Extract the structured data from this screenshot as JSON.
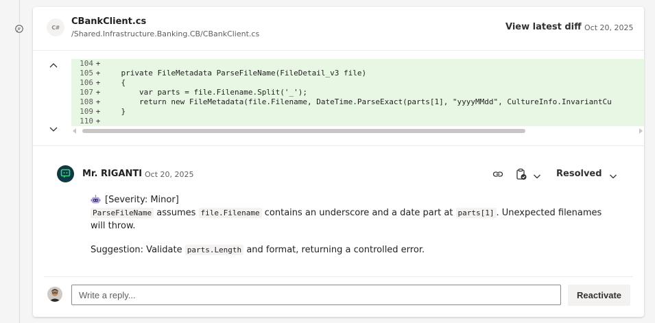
{
  "file": {
    "language_badge": "C#",
    "name": "CBankClient.cs",
    "path": "/Shared.Infrastructure.Banking.CB/CBankClient.cs",
    "view_diff_label": "View latest diff",
    "date": "Oct 20, 2025"
  },
  "diff": {
    "lines": [
      {
        "num": "104",
        "marker": "+",
        "code": ""
      },
      {
        "num": "105",
        "marker": "+",
        "code": "    private FileMetadata ParseFileName(FileDetail_v3 file)"
      },
      {
        "num": "106",
        "marker": "+",
        "code": "    {"
      },
      {
        "num": "107",
        "marker": "+",
        "code": "        var parts = file.Filename.Split('_');"
      },
      {
        "num": "108",
        "marker": "+",
        "code": "        return new FileMetadata(file.Filename, DateTime.ParseExact(parts[1], \"yyyyMMdd\", CultureInfo.InvariantCu"
      },
      {
        "num": "109",
        "marker": "+",
        "code": "    }"
      },
      {
        "num": "110",
        "marker": "+",
        "code": ""
      }
    ],
    "added_line_color": "#e8f6e4"
  },
  "comment": {
    "author": "Mr. RIGANTI",
    "date": "Oct 20, 2025",
    "status": "Resolved",
    "severity": "[Severity: Minor]",
    "body1": {
      "code1": "ParseFileName",
      "text1": " assumes ",
      "code2": "file.Filename",
      "text2": " contains an underscore and a date part at ",
      "code3": "parts[1]",
      "text3": ". Unexpected filenames will throw."
    },
    "body2": {
      "text1": "Suggestion: Validate ",
      "code1": "parts.Length",
      "text2": " and format, returning a controlled error."
    }
  },
  "reply": {
    "placeholder": "Write a reply...",
    "reactivate_label": "Reactivate"
  },
  "colors": {
    "bot_avatar": "#0e3b43",
    "bot_avatar_glyph": "#3cd27c"
  }
}
